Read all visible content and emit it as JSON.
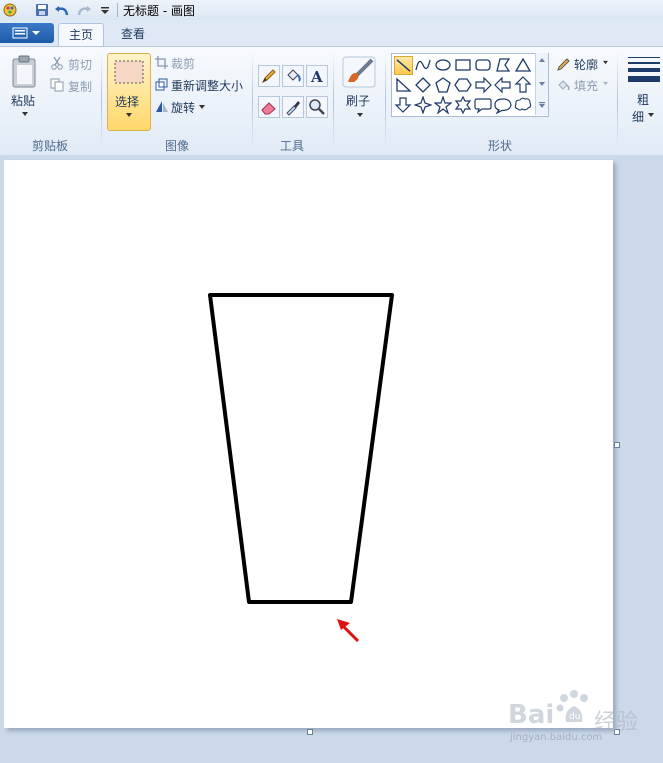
{
  "window": {
    "title": "无标题 - 画图"
  },
  "tabs": [
    {
      "label": "主页"
    },
    {
      "label": "查看"
    }
  ],
  "clipboard": {
    "paste_label": "粘贴",
    "cut_label": "剪切",
    "copy_label": "复制",
    "group_label": "剪贴板"
  },
  "image": {
    "select_label": "选择",
    "crop_label": "裁剪",
    "resize_label": "重新调整大小",
    "rotate_label": "旋转",
    "group_label": "图像"
  },
  "tools": {
    "group_label": "工具"
  },
  "brushes": {
    "label": "刷子"
  },
  "shapes": {
    "group_label": "形状",
    "outline_label": "轮廓",
    "fill_label": "填充"
  },
  "size": {
    "label_line1": "粗",
    "label_line2": "细"
  },
  "watermark": {
    "brand": "Bai",
    "brand_cn": "经验",
    "url": "jingyan.baidu.com"
  },
  "colors": {
    "accent_selected": "#ffd86b",
    "drawing_stroke": "#000000",
    "arrow": "#e01010"
  }
}
